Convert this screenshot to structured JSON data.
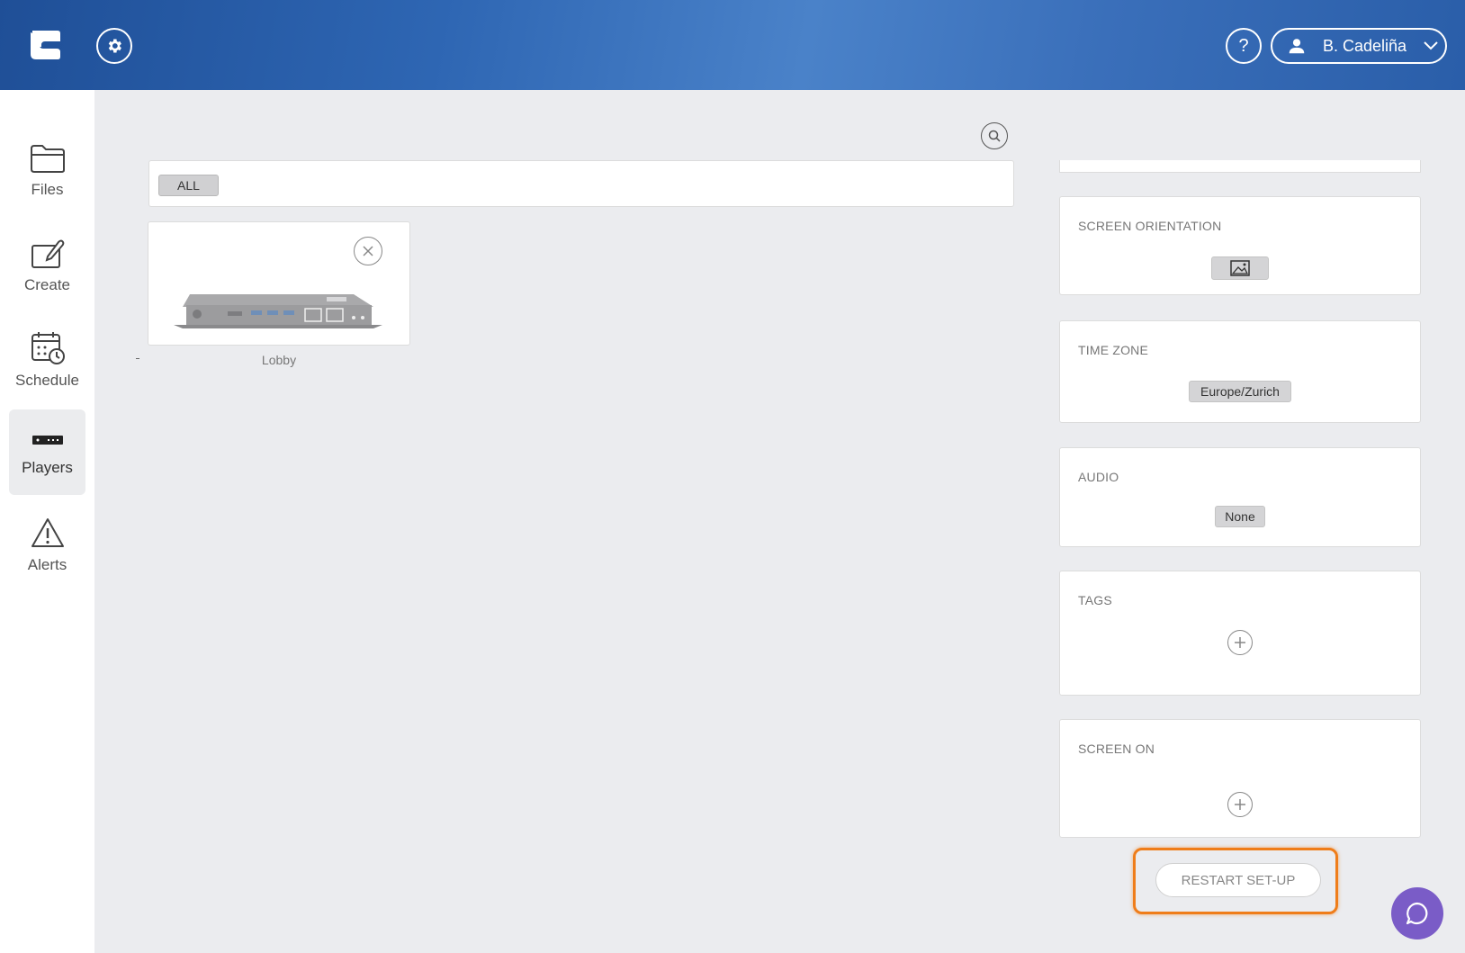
{
  "header": {
    "help_label": "?",
    "user_name": "B. Cadeliña"
  },
  "sidebar": {
    "items": [
      {
        "label": "Files",
        "icon": "folder-icon"
      },
      {
        "label": "Create",
        "icon": "create-icon"
      },
      {
        "label": "Schedule",
        "icon": "calendar-clock-icon"
      },
      {
        "label": "Players",
        "icon": "player-device-icon",
        "active": true
      },
      {
        "label": "Alerts",
        "icon": "warning-icon"
      }
    ]
  },
  "filter": {
    "chip": "ALL"
  },
  "players": [
    {
      "name": "Lobby"
    }
  ],
  "settings": {
    "screen_orientation": {
      "title": "SCREEN ORIENTATION"
    },
    "time_zone": {
      "title": "TIME ZONE",
      "value": "Europe/Zurich"
    },
    "audio": {
      "title": "AUDIO",
      "value": "None"
    },
    "tags": {
      "title": "TAGS"
    },
    "screen_on": {
      "title": "SCREEN ON"
    },
    "restart_label": "RESTART SET-UP"
  },
  "colors": {
    "header_blue": "#2e66b3",
    "highlight_orange": "#ef7d1a",
    "chat_purple": "#7a5cc7"
  }
}
